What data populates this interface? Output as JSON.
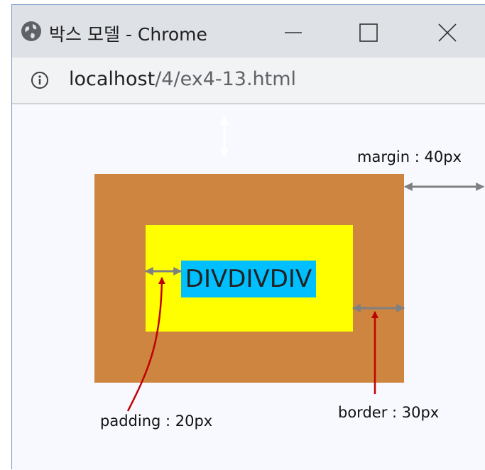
{
  "window": {
    "title": "박스 모델 - Chrome",
    "icon": "globe-icon",
    "controls": [
      "minimize-icon",
      "maximize-icon",
      "close-icon"
    ]
  },
  "address": {
    "icon": "info-icon",
    "host": "localhost",
    "path": "/4/ex4-13.html"
  },
  "page": {
    "div_text": "DIVDIVDIV",
    "labels": {
      "margin": "margin : 40px",
      "padding": "padding : 20px",
      "border": "border : 30px"
    },
    "colors": {
      "border": "#cd853f",
      "padding": "#ffff00",
      "content": "#00bfff",
      "arrow": "#808080",
      "pointer": "#c00000"
    }
  }
}
